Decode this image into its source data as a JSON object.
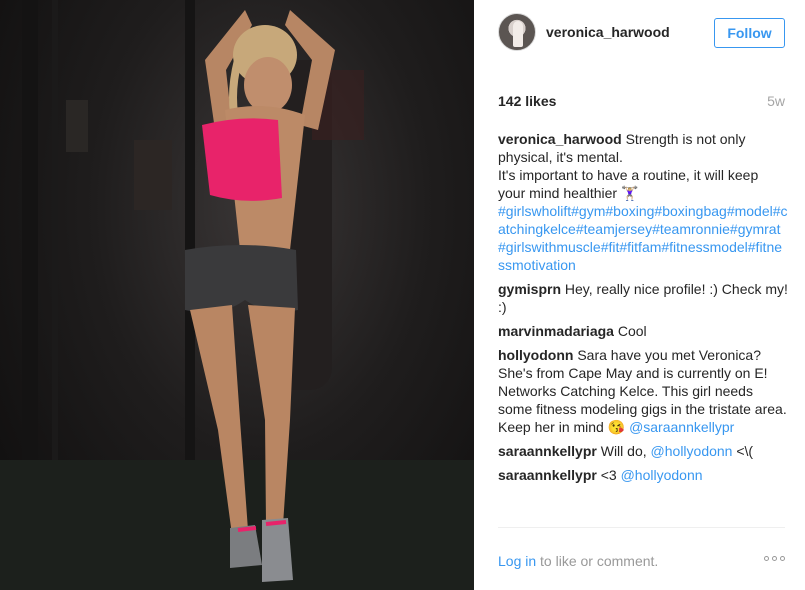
{
  "post": {
    "username": "veronica_harwood",
    "follow_label": "Follow",
    "likes": "142 likes",
    "age": "5w",
    "caption": {
      "user": "veronica_harwood",
      "line1": "Strength is not only physical, it's mental.",
      "line2": "It's important to have a routine, it will keep your mind healthier 🏋🏼‍♀️",
      "hashtags": "#girlswholift#gym#boxing#boxingbag#model#catchingkelce#teamjersey#teamronnie#gymrat#girlswithmuscle#fit#fitfam#fitnessmodel#fitnessmotivation"
    },
    "comments": [
      {
        "user": "gymisprn",
        "text": "Hey, really nice profile! :) Check my! :)"
      },
      {
        "user": "marvinmadariaga",
        "text": "Cool"
      },
      {
        "user": "hollyodonn",
        "text": "Sara have you met Veronica? She's from Cape May and is currently on E! Networks Catching Kelce. This girl needs some fitness modeling gigs in the tristate area. Keep her in mind 😘",
        "mention": "@saraannkellypr"
      },
      {
        "user": "saraannkellypr",
        "text": "Will do,",
        "mention": "@hollyodonn",
        "suffix": "<\\("
      },
      {
        "user": "saraannkellypr",
        "text": "<3",
        "mention": "@hollyodonn"
      }
    ],
    "footer": {
      "login_label": "Log in",
      "rest": " to like or comment."
    }
  },
  "colors": {
    "accent": "#3897f0",
    "text": "#262626",
    "muted": "#999999",
    "bra": "#e8236a"
  }
}
